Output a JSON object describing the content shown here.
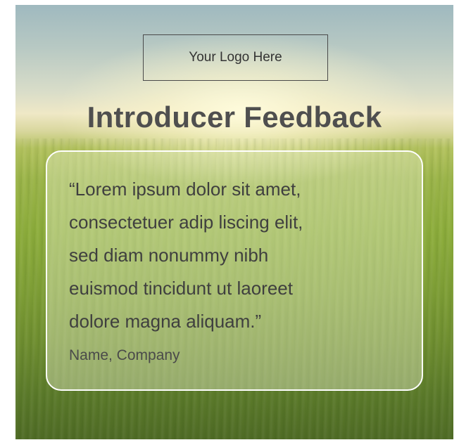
{
  "logo": {
    "label": "Your Logo Here"
  },
  "heading": {
    "title": "Introducer Feedback"
  },
  "testimonial": {
    "quote_lines": [
      "“Lorem ipsum dolor sit amet,",
      "consectetuer adip liscing elit,",
      "sed diam nonummy nibh",
      "euismod tincidunt ut laoreet",
      "dolore magna aliquam.”"
    ],
    "attribution": "Name, Company"
  },
  "colors": {
    "title_text": "#4f4f4f",
    "card_border": "#ffffff",
    "body_text": "#3f3f3f",
    "grass_green": "#8eae3c",
    "sky": "#9fb9bf"
  }
}
